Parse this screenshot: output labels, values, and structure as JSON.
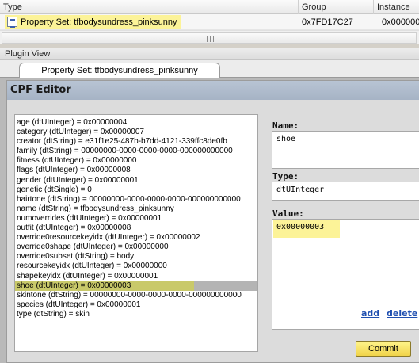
{
  "grid": {
    "columns": [
      "Type",
      "Group",
      "Instance"
    ],
    "row": {
      "type": "Property Set: tfbodysundress_pinksunny",
      "group": "0x7FD17C27",
      "instance": "0x000000"
    }
  },
  "plugin_view": {
    "title": "Plugin View",
    "tab": "Property Set: tfbodysundress_pinksunny"
  },
  "cpf_editor": {
    "title": "CPF Editor",
    "properties": [
      "age (dtUInteger) = 0x00000004",
      "category (dtUInteger) = 0x00000007",
      "creator (dtString) = e31f1e25-487b-b7dd-4121-339ffc8de0fb",
      "family (dtString) = 00000000-0000-0000-0000-000000000000",
      "fitness (dtUInteger) = 0x00000000",
      "flags (dtUInteger) = 0x00000008",
      "gender (dtUInteger) = 0x00000001",
      "genetic (dtSingle) = 0",
      "hairtone (dtString) = 00000000-0000-0000-0000-000000000000",
      "name (dtString) = tfbodysundress_pinksunny",
      "numoverrides (dtUInteger) = 0x00000001",
      "outfit (dtUInteger) = 0x00000008",
      "override0resourcekeyidx (dtUInteger) = 0x00000002",
      "override0shape (dtUInteger) = 0x00000000",
      "override0subset (dtString) = body",
      "resourcekeyidx (dtUInteger) = 0x00000000",
      "shapekeyidx (dtUInteger) = 0x00000001",
      "shoe (dtUInteger) = 0x00000003",
      "skintone (dtString) = 00000000-0000-0000-0000-000000000000",
      "species (dtUInteger) = 0x00000001",
      "type (dtString) = skin"
    ],
    "selected_index": 17,
    "name_label": "Name:",
    "name_value": "shoe",
    "type_label": "Type:",
    "type_value": "dtUInteger",
    "value_label": "Value:",
    "value_value": "0x00000003",
    "add_label": "add",
    "delete_label": "delete",
    "commit_label": "Commit"
  },
  "colors": {
    "highlight_yellow": "#fcf398",
    "selected_row": "#c9c96a",
    "link_blue": "#1f4fb0"
  }
}
